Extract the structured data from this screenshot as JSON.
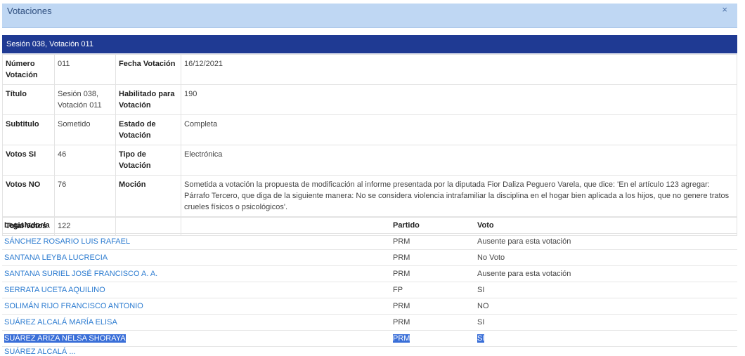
{
  "dialog": {
    "title": "Votaciones",
    "close": "×"
  },
  "session_bar": "Sesión 038, Votación 011",
  "info": {
    "numero_label": "Número Votación",
    "numero": "011",
    "fecha_label": "Fecha Votación",
    "fecha": "16/12/2021",
    "titulo_label": "Título",
    "titulo": "Sesión 038, Votación 011",
    "habilitado_label": "Habilitado para Votación",
    "habilitado": "190",
    "subtitulo_label": "Subtitulo",
    "subtitulo": "Sometido",
    "estado_label": "Estado de Votación",
    "estado": "Completa",
    "votos_si_label": "Votos SI",
    "votos_si": "46",
    "tipo_label": "Tipo de Votación",
    "tipo": "Electrónica",
    "votos_no_label": "Votos NO",
    "votos_no": "76",
    "mocion_label": "Moción",
    "mocion": "Sometida a votación la propuesta de modificación al informe presentada por la diputada Fior Daliza Peguero Varela, que dice: 'En el artículo 123 agregar: Párrafo Tercero, que diga de la siguiente manera: No se considera violencia intrafamiliar la disciplina en el hogar bien aplicada a los hijos, que no genere tratos crueles físicos o psicológicos'.",
    "total_label": "Total Votos",
    "total": "122"
  },
  "votes_table": {
    "headers": {
      "legislador": "Legislador/a",
      "partido": "Partido",
      "voto": "Voto"
    },
    "rows": [
      {
        "name": "SÁNCHEZ ROSARIO LUIS RAFAEL",
        "party": "PRM",
        "vote": "Ausente para esta votación"
      },
      {
        "name": "SANTANA LEYBA LUCRECIA",
        "party": "PRM",
        "vote": "No Voto"
      },
      {
        "name": "SANTANA SURIEL JOSÉ FRANCISCO A. A.",
        "party": "PRM",
        "vote": "Ausente para esta votación"
      },
      {
        "name": "SERRATA UCETA AQUILINO",
        "party": "FP",
        "vote": "SI"
      },
      {
        "name": "SOLIMÁN RIJO FRANCISCO ANTONIO",
        "party": "PRM",
        "vote": "NO"
      },
      {
        "name": "SUÁREZ ALCALÁ MARÍA ELISA",
        "party": "PRM",
        "vote": "SI"
      },
      {
        "name": "SUÁREZ ARIZA NELSA SHORAYA",
        "party": "PRM",
        "vote": "SI"
      }
    ],
    "partial_next": "SUÁREZ ALCALÁ ..."
  }
}
